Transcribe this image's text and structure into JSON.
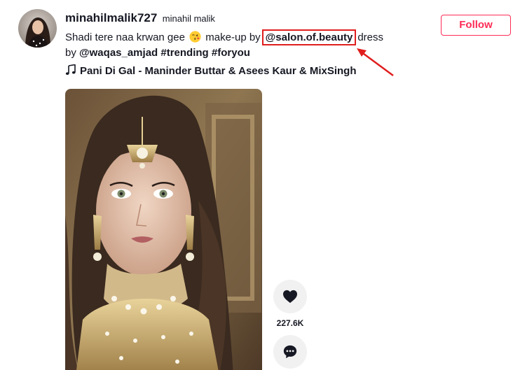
{
  "post": {
    "username": "minahilmalik727",
    "nickname": "minahil malik",
    "follow_label": "Follow",
    "caption": {
      "text_1": "Shadi tere naa krwan gee",
      "text_2": "make-up by",
      "mention_highlighted": "@salon.of.beauty",
      "text_3": "dress",
      "text_4": "by",
      "mention_2": "@waqas_amjad",
      "tag_1": "#trending",
      "tag_2": "#foryou"
    },
    "music": "Pani Di Gal - Maninder Buttar & Asees Kaur & MixSingh"
  },
  "actions": {
    "like_count": "227.6K"
  },
  "colors": {
    "accent": "#fe2c55",
    "highlight": "#e01e1e",
    "text": "#161823",
    "action_bg": "#f1f1f2"
  }
}
